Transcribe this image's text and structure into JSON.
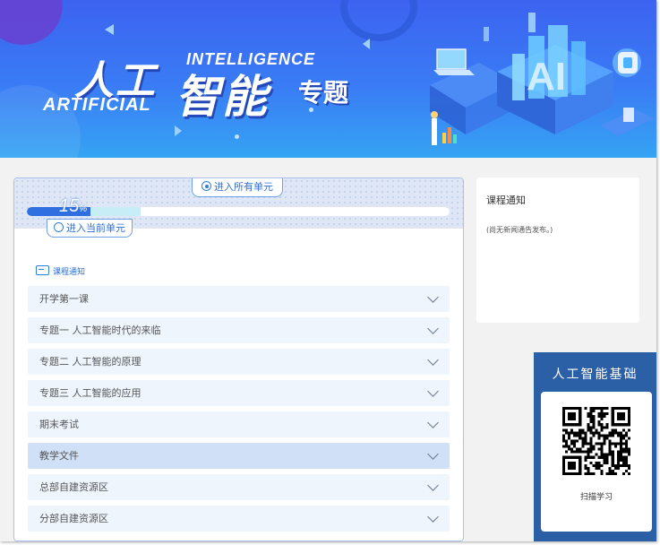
{
  "banner": {
    "title_cn_part1": "人工",
    "title_cn_part2": "智能",
    "title_cn_part3": "专题",
    "title_en_top": "INTELLIGENCE",
    "title_en_bottom": "ARTIFICIAL"
  },
  "course": {
    "enter_all_label": "进入所有单元",
    "enter_current_label": "进入当前单元",
    "progress_percent": 15,
    "progress_number": "15",
    "progress_unit": "%",
    "notice_link_label": "课程通知"
  },
  "units": [
    {
      "label": "开学第一课"
    },
    {
      "label": "专题一 人工智能时代的来临"
    },
    {
      "label": "专题二 人工智能的原理"
    },
    {
      "label": "专题三 人工智能的应用"
    },
    {
      "label": "期末考试"
    },
    {
      "label": "教学文件"
    },
    {
      "label": "总部自建资源区"
    },
    {
      "label": "分部自建资源区"
    }
  ],
  "active_unit_index": 5,
  "notice_panel": {
    "title": "课程通知",
    "empty_text": "(尚无新闻通告发布。)"
  },
  "qr_widget": {
    "title": "人工智能基础",
    "caption": "扫描学习"
  },
  "colors": {
    "accent": "#2f6fe0",
    "banner_top": "#3c63f0",
    "banner_bottom": "#35a4f2",
    "qr_widget_bg": "#2b5fa6"
  }
}
